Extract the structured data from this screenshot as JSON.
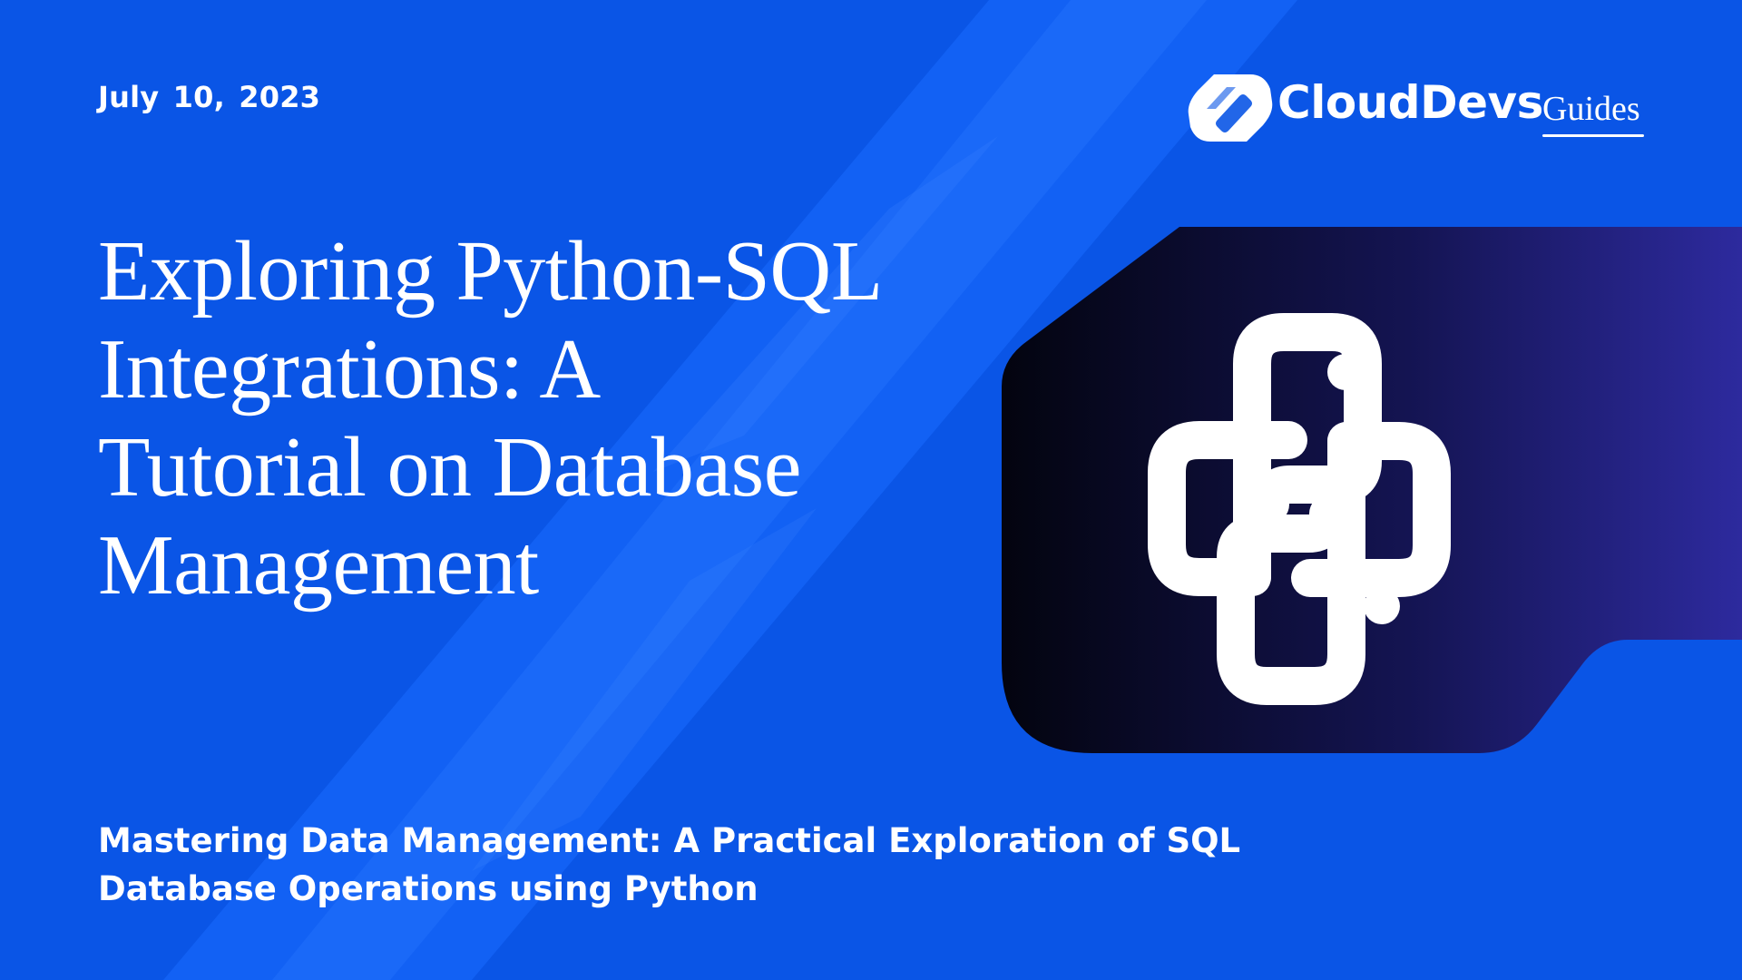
{
  "date": "July 10,  2023",
  "logo": {
    "brand": "CloudDevs",
    "suffix": "Guides",
    "icon": "clouddevs-logo-icon"
  },
  "title_lines": [
    "Exploring Python-SQL",
    "Integrations: A",
    "Tutorial on Database",
    "Management"
  ],
  "subtitle_lines": [
    "Mastering Data Management: A Practical Exploration of SQL",
    "Database Operations using Python"
  ],
  "icon": "python-logo-icon",
  "colors": {
    "background": "#0a55e6",
    "stripe": "#1a6cff",
    "card_start": "#03040f",
    "card_end": "#2d2a9e",
    "text": "#ffffff"
  }
}
